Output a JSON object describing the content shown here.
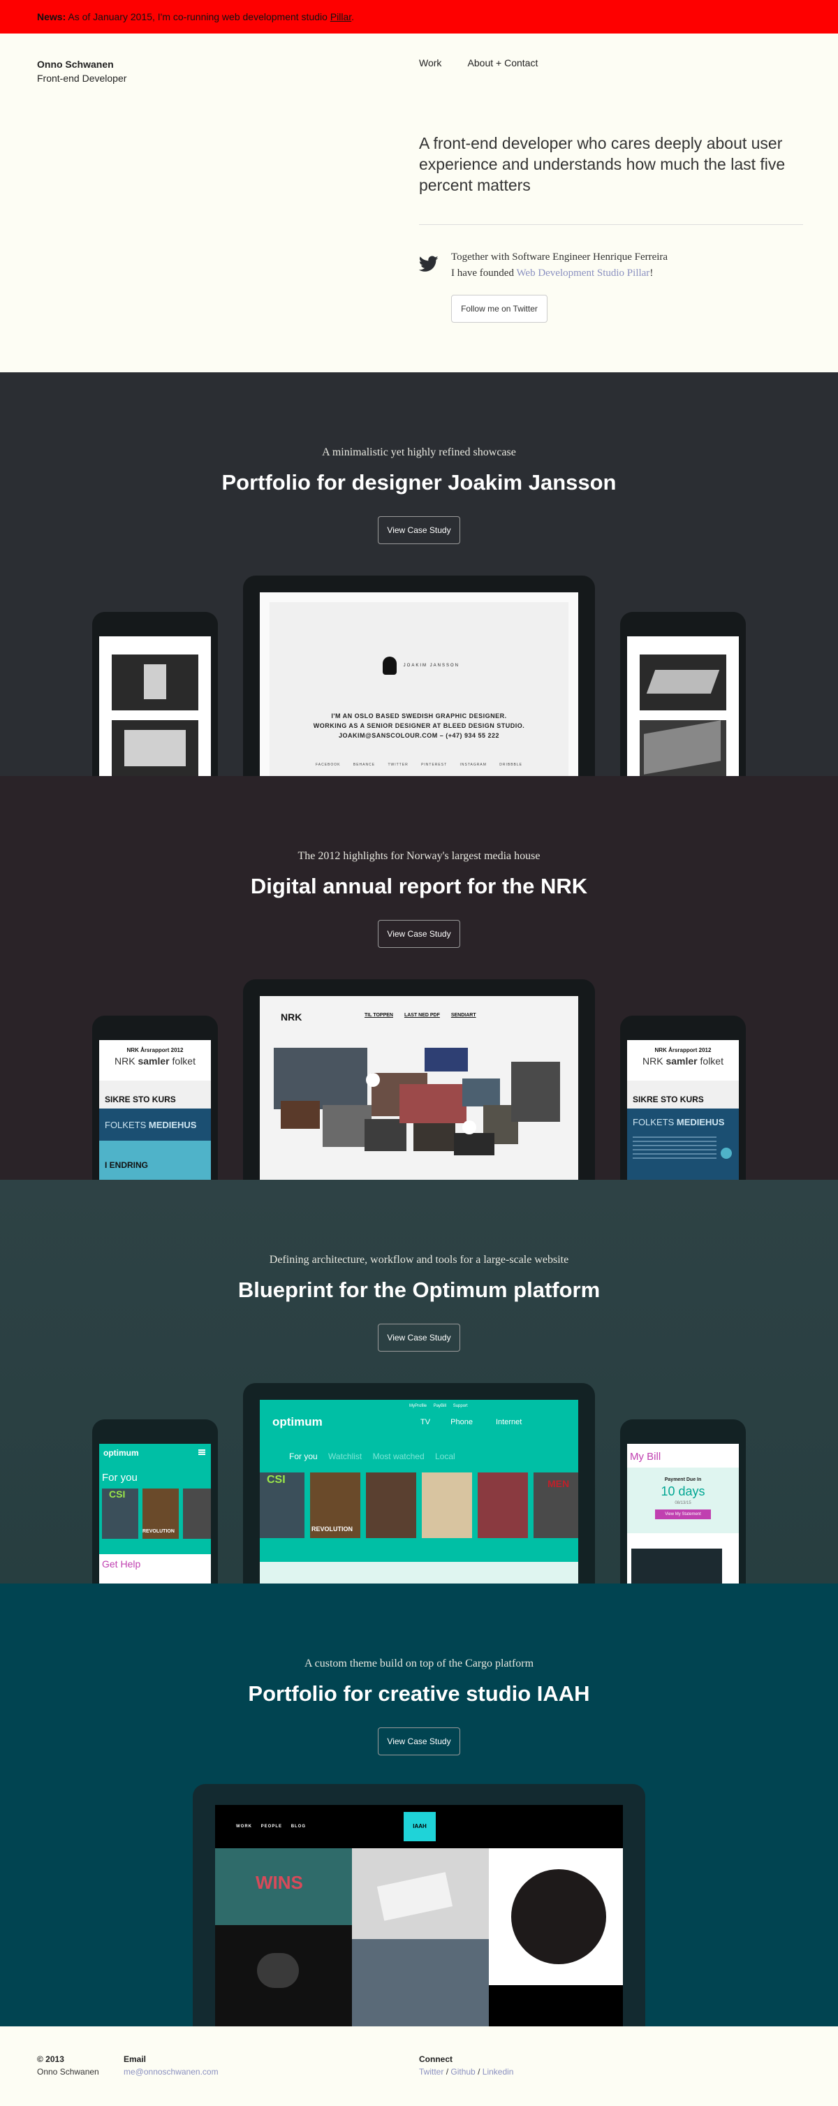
{
  "news": {
    "label": "News:",
    "text": "As of January 2015, I'm co-running web development studio",
    "link": "Pillar",
    "suffix": "."
  },
  "brand": {
    "name": "Onno Schwanen",
    "role": "Front-end Developer"
  },
  "nav": {
    "work": "Work",
    "about": "About + Contact"
  },
  "intro": "A front-end developer who cares deeply about user experience and understands how much the last five percent matters",
  "twitter": {
    "line1": "Together with Software Engineer Henrique Ferreira",
    "line2_prefix": "I have founded ",
    "line2_link": "Web Development Studio Pillar",
    "line2_suffix": "!",
    "follow": "Follow me on Twitter"
  },
  "sections": [
    {
      "subtitle": "A minimalistic yet highly refined showcase",
      "title": "Portfolio for designer Joakim Jansson",
      "cta": "View Case Study",
      "bg": "#2b2e33"
    },
    {
      "subtitle": "The 2012 highlights for Norway's largest media house",
      "title": "Digital annual report for the NRK",
      "cta": "View Case Study",
      "bg": "#2a2328"
    },
    {
      "subtitle": "Defining architecture, workflow and tools for a large-scale website",
      "title": "Blueprint for the Optimum platform",
      "cta": "View Case Study",
      "bg": "#2e3f42"
    },
    {
      "subtitle": "A custom theme build on top of the Cargo platform",
      "title": "Portfolio for creative studio IAAH",
      "cta": "View Case Study",
      "bg": "#014451"
    }
  ],
  "joakim": {
    "logo": "JOAKIM JANSSON",
    "line1": "I'M AN OSLO BASED SWEDISH GRAPHIC DESIGNER.",
    "line2": "WORKING AS A SENIOR DESIGNER AT BLEED DESIGN STUDIO.",
    "line3": "JOAKIM@SANSCOLOUR.COM – (+47) 934 55 222",
    "links": [
      "FACEBOOK",
      "BEHANCE",
      "TWITTER",
      "PINTEREST",
      "INSTAGRAM",
      "DRIBBBLE"
    ]
  },
  "nrk": {
    "logo": "NRK",
    "nav": [
      "TIL TOPPEN",
      "LAST NED PDF",
      "SENDIART"
    ],
    "phone_title1": "NRK Årsrapport 2012",
    "phone_title2a": "NRK ",
    "phone_title2b": "samler",
    "phone_title2c": " folket",
    "band1": "SIKRE STO KURS",
    "band2a": "FOLKETS ",
    "band2b": "MEDIEHUS",
    "band3": "I ENDRING"
  },
  "optimum": {
    "logo": "optimum",
    "tabs": [
      "For you",
      "Watchlist",
      "Most watched",
      "Local"
    ],
    "topnav": [
      "TV",
      "Phone",
      "Internet"
    ],
    "utility": [
      "MyProfile",
      "PayBill",
      "Support"
    ],
    "phone_for_you": "For you",
    "phone_get_help": "Get Help",
    "bill_title": "My Bill",
    "bill_payment": "Payment Due In",
    "bill_days": "10 days",
    "bill_date": "08/13/15",
    "bill_button": "View My Statement",
    "poster_words": [
      "CSI",
      "REVOLUTION",
      "MEN"
    ]
  },
  "iaah": {
    "nav": [
      "WORK",
      "PEOPLE",
      "BLOG"
    ],
    "logo": "IAAH",
    "tile_word": "WINS"
  },
  "footer": {
    "year": "© 2013",
    "name": "Onno Schwanen",
    "email_label": "Email",
    "email": "me@onnoschwanen.com",
    "connect_label": "Connect",
    "twitter": "Twitter",
    "github": "Github",
    "linkedin": "Linkedin",
    "sep": "/"
  }
}
